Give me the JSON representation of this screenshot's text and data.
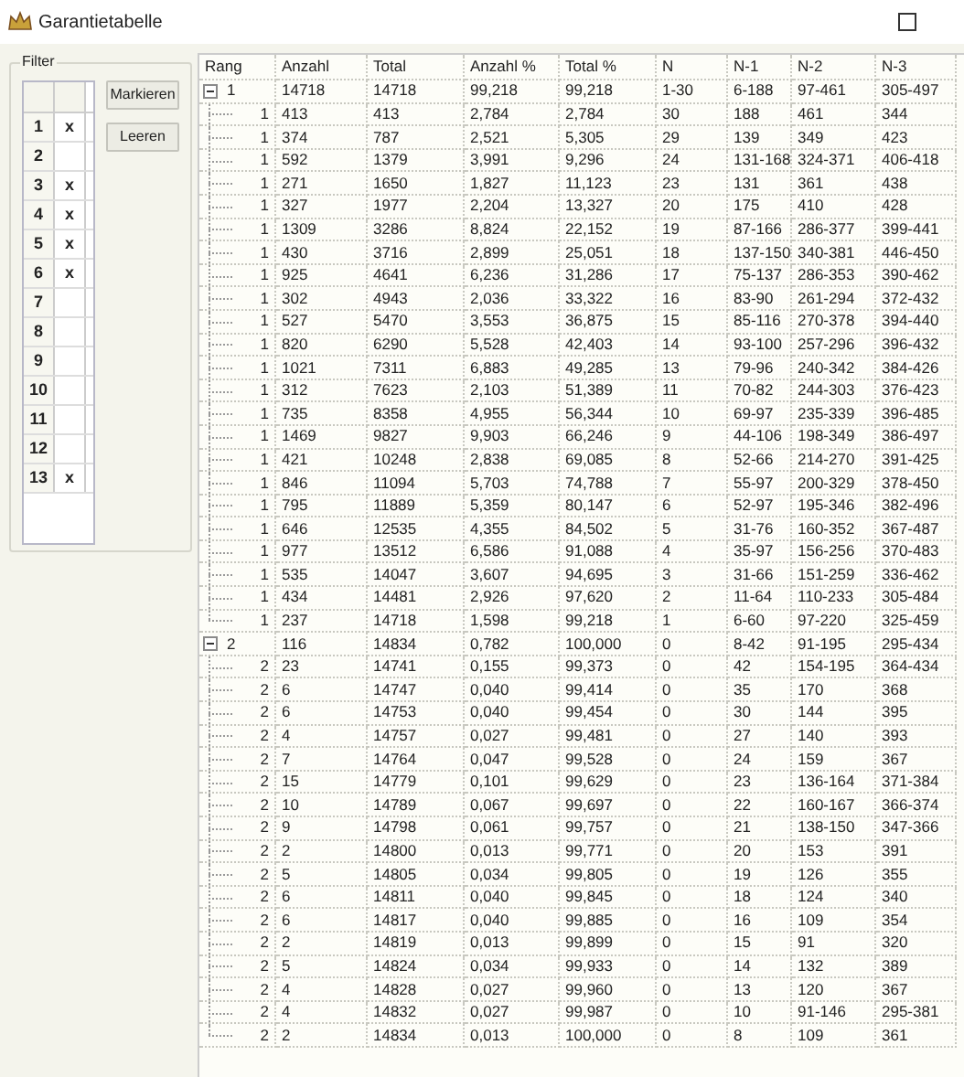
{
  "window": {
    "title": "Garantietabelle"
  },
  "filter": {
    "title": "Filter",
    "rows": [
      {
        "number": "1",
        "mark": "x"
      },
      {
        "number": "2"
      },
      {
        "number": "3",
        "mark": "x"
      },
      {
        "number": "4",
        "mark": "x"
      },
      {
        "number": "5",
        "mark": "x"
      },
      {
        "number": "6",
        "mark": "x"
      },
      {
        "number": "7"
      },
      {
        "number": "8"
      },
      {
        "number": "9"
      },
      {
        "number": "10"
      },
      {
        "number": "11"
      },
      {
        "number": "12"
      },
      {
        "number": "13",
        "mark": "x"
      }
    ],
    "buttons": [
      "Markieren",
      "Leeren"
    ]
  },
  "table": {
    "columns": [
      "Rang",
      "Anzahl",
      "Total",
      "Anzahl %",
      "Total %",
      "N",
      "N-1",
      "N-2",
      "N-3"
    ],
    "groups": [
      {
        "rang": "1",
        "expanded": true,
        "cells": [
          "14718",
          "14718",
          "99,218",
          "99,218",
          "1-30",
          "6-188",
          "97-461",
          "305-497"
        ],
        "children": [
          {
            "rang": "1",
            "cells": [
              "413",
              "413",
              "2,784",
              "2,784",
              "30",
              "188",
              "461",
              "344"
            ]
          },
          {
            "rang": "1",
            "cells": [
              "374",
              "787",
              "2,521",
              "5,305",
              "29",
              "139",
              "349",
              "423"
            ]
          },
          {
            "rang": "1",
            "cells": [
              "592",
              "1379",
              "3,991",
              "9,296",
              "24",
              "131-168",
              "324-371",
              "406-418"
            ]
          },
          {
            "rang": "1",
            "cells": [
              "271",
              "1650",
              "1,827",
              "11,123",
              "23",
              "131",
              "361",
              "438"
            ]
          },
          {
            "rang": "1",
            "cells": [
              "327",
              "1977",
              "2,204",
              "13,327",
              "20",
              "175",
              "410",
              "428"
            ]
          },
          {
            "rang": "1",
            "cells": [
              "1309",
              "3286",
              "8,824",
              "22,152",
              "19",
              "87-166",
              "286-377",
              "399-441"
            ]
          },
          {
            "rang": "1",
            "cells": [
              "430",
              "3716",
              "2,899",
              "25,051",
              "18",
              "137-150",
              "340-381",
              "446-450"
            ]
          },
          {
            "rang": "1",
            "cells": [
              "925",
              "4641",
              "6,236",
              "31,286",
              "17",
              "75-137",
              "286-353",
              "390-462"
            ]
          },
          {
            "rang": "1",
            "cells": [
              "302",
              "4943",
              "2,036",
              "33,322",
              "16",
              "83-90",
              "261-294",
              "372-432"
            ]
          },
          {
            "rang": "1",
            "cells": [
              "527",
              "5470",
              "3,553",
              "36,875",
              "15",
              "85-116",
              "270-378",
              "394-440"
            ]
          },
          {
            "rang": "1",
            "cells": [
              "820",
              "6290",
              "5,528",
              "42,403",
              "14",
              "93-100",
              "257-296",
              "396-432"
            ]
          },
          {
            "rang": "1",
            "cells": [
              "1021",
              "7311",
              "6,883",
              "49,285",
              "13",
              "79-96",
              "240-342",
              "384-426"
            ]
          },
          {
            "rang": "1",
            "cells": [
              "312",
              "7623",
              "2,103",
              "51,389",
              "11",
              "70-82",
              "244-303",
              "376-423"
            ]
          },
          {
            "rang": "1",
            "cells": [
              "735",
              "8358",
              "4,955",
              "56,344",
              "10",
              "69-97",
              "235-339",
              "396-485"
            ]
          },
          {
            "rang": "1",
            "cells": [
              "1469",
              "9827",
              "9,903",
              "66,246",
              "9",
              "44-106",
              "198-349",
              "386-497"
            ]
          },
          {
            "rang": "1",
            "cells": [
              "421",
              "10248",
              "2,838",
              "69,085",
              "8",
              "52-66",
              "214-270",
              "391-425"
            ]
          },
          {
            "rang": "1",
            "cells": [
              "846",
              "11094",
              "5,703",
              "74,788",
              "7",
              "55-97",
              "200-329",
              "378-450"
            ]
          },
          {
            "rang": "1",
            "cells": [
              "795",
              "11889",
              "5,359",
              "80,147",
              "6",
              "52-97",
              "195-346",
              "382-496"
            ]
          },
          {
            "rang": "1",
            "cells": [
              "646",
              "12535",
              "4,355",
              "84,502",
              "5",
              "31-76",
              "160-352",
              "367-487"
            ]
          },
          {
            "rang": "1",
            "cells": [
              "977",
              "13512",
              "6,586",
              "91,088",
              "4",
              "35-97",
              "156-256",
              "370-483"
            ]
          },
          {
            "rang": "1",
            "cells": [
              "535",
              "14047",
              "3,607",
              "94,695",
              "3",
              "31-66",
              "151-259",
              "336-462"
            ]
          },
          {
            "rang": "1",
            "cells": [
              "434",
              "14481",
              "2,926",
              "97,620",
              "2",
              "11-64",
              "110-233",
              "305-484"
            ]
          },
          {
            "rang": "1",
            "cells": [
              "237",
              "14718",
              "1,598",
              "99,218",
              "1",
              "6-60",
              "97-220",
              "325-459"
            ]
          }
        ]
      },
      {
        "rang": "2",
        "expanded": true,
        "cells": [
          "116",
          "14834",
          "0,782",
          "100,000",
          "0",
          "8-42",
          "91-195",
          "295-434"
        ],
        "children": [
          {
            "rang": "2",
            "cells": [
              "23",
              "14741",
              "0,155",
              "99,373",
              "0",
              "42",
              "154-195",
              "364-434"
            ]
          },
          {
            "rang": "2",
            "cells": [
              "6",
              "14747",
              "0,040",
              "99,414",
              "0",
              "35",
              "170",
              "368"
            ]
          },
          {
            "rang": "2",
            "cells": [
              "6",
              "14753",
              "0,040",
              "99,454",
              "0",
              "30",
              "144",
              "395"
            ]
          },
          {
            "rang": "2",
            "cells": [
              "4",
              "14757",
              "0,027",
              "99,481",
              "0",
              "27",
              "140",
              "393"
            ]
          },
          {
            "rang": "2",
            "cells": [
              "7",
              "14764",
              "0,047",
              "99,528",
              "0",
              "24",
              "159",
              "367"
            ]
          },
          {
            "rang": "2",
            "cells": [
              "15",
              "14779",
              "0,101",
              "99,629",
              "0",
              "23",
              "136-164",
              "371-384"
            ]
          },
          {
            "rang": "2",
            "cells": [
              "10",
              "14789",
              "0,067",
              "99,697",
              "0",
              "22",
              "160-167",
              "366-374"
            ]
          },
          {
            "rang": "2",
            "cells": [
              "9",
              "14798",
              "0,061",
              "99,757",
              "0",
              "21",
              "138-150",
              "347-366"
            ]
          },
          {
            "rang": "2",
            "cells": [
              "2",
              "14800",
              "0,013",
              "99,771",
              "0",
              "20",
              "153",
              "391"
            ]
          },
          {
            "rang": "2",
            "cells": [
              "5",
              "14805",
              "0,034",
              "99,805",
              "0",
              "19",
              "126",
              "355"
            ]
          },
          {
            "rang": "2",
            "cells": [
              "6",
              "14811",
              "0,040",
              "99,845",
              "0",
              "18",
              "124",
              "340"
            ]
          },
          {
            "rang": "2",
            "cells": [
              "6",
              "14817",
              "0,040",
              "99,885",
              "0",
              "16",
              "109",
              "354"
            ]
          },
          {
            "rang": "2",
            "cells": [
              "2",
              "14819",
              "0,013",
              "99,899",
              "0",
              "15",
              "91",
              "320"
            ]
          },
          {
            "rang": "2",
            "cells": [
              "5",
              "14824",
              "0,034",
              "99,933",
              "0",
              "14",
              "132",
              "389"
            ]
          },
          {
            "rang": "2",
            "cells": [
              "4",
              "14828",
              "0,027",
              "99,960",
              "0",
              "13",
              "120",
              "367"
            ]
          },
          {
            "rang": "2",
            "cells": [
              "4",
              "14832",
              "0,027",
              "99,987",
              "0",
              "10",
              "91-146",
              "295-381"
            ]
          },
          {
            "rang": "2",
            "cells": [
              "2",
              "14834",
              "0,013",
              "100,000",
              "0",
              "8",
              "109",
              "361"
            ]
          }
        ]
      }
    ]
  }
}
